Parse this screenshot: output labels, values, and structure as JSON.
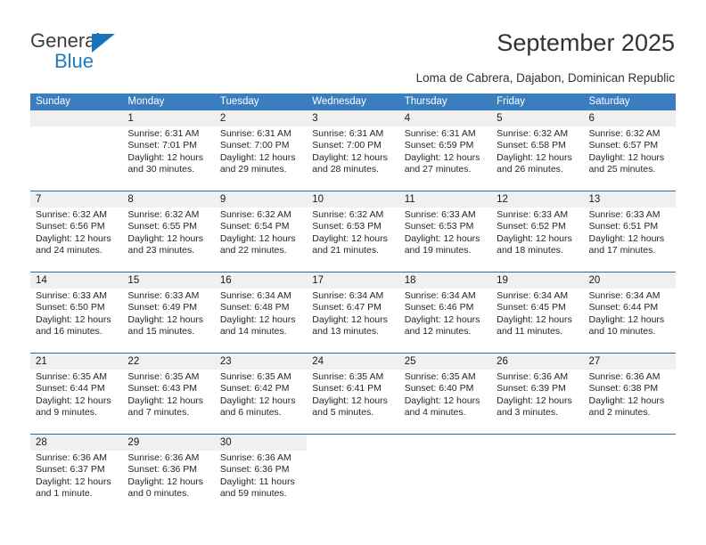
{
  "brand": {
    "name_top": "General",
    "name_bottom": "Blue",
    "accent_color": "#1a7dc4"
  },
  "header": {
    "title": "September 2025",
    "location": "Loma de Cabrera, Dajabon, Dominican Republic"
  },
  "theme": {
    "header_row_bg": "#3a7ebf",
    "day_number_bg": "#f0f0f0",
    "row_divider": "#2a6aa8"
  },
  "weekdays": [
    "Sunday",
    "Monday",
    "Tuesday",
    "Wednesday",
    "Thursday",
    "Friday",
    "Saturday"
  ],
  "weeks": [
    [
      {
        "day": "",
        "lines": []
      },
      {
        "day": "1",
        "lines": [
          "Sunrise: 6:31 AM",
          "Sunset: 7:01 PM",
          "Daylight: 12 hours",
          "and 30 minutes."
        ]
      },
      {
        "day": "2",
        "lines": [
          "Sunrise: 6:31 AM",
          "Sunset: 7:00 PM",
          "Daylight: 12 hours",
          "and 29 minutes."
        ]
      },
      {
        "day": "3",
        "lines": [
          "Sunrise: 6:31 AM",
          "Sunset: 7:00 PM",
          "Daylight: 12 hours",
          "and 28 minutes."
        ]
      },
      {
        "day": "4",
        "lines": [
          "Sunrise: 6:31 AM",
          "Sunset: 6:59 PM",
          "Daylight: 12 hours",
          "and 27 minutes."
        ]
      },
      {
        "day": "5",
        "lines": [
          "Sunrise: 6:32 AM",
          "Sunset: 6:58 PM",
          "Daylight: 12 hours",
          "and 26 minutes."
        ]
      },
      {
        "day": "6",
        "lines": [
          "Sunrise: 6:32 AM",
          "Sunset: 6:57 PM",
          "Daylight: 12 hours",
          "and 25 minutes."
        ]
      }
    ],
    [
      {
        "day": "7",
        "lines": [
          "Sunrise: 6:32 AM",
          "Sunset: 6:56 PM",
          "Daylight: 12 hours",
          "and 24 minutes."
        ]
      },
      {
        "day": "8",
        "lines": [
          "Sunrise: 6:32 AM",
          "Sunset: 6:55 PM",
          "Daylight: 12 hours",
          "and 23 minutes."
        ]
      },
      {
        "day": "9",
        "lines": [
          "Sunrise: 6:32 AM",
          "Sunset: 6:54 PM",
          "Daylight: 12 hours",
          "and 22 minutes."
        ]
      },
      {
        "day": "10",
        "lines": [
          "Sunrise: 6:32 AM",
          "Sunset: 6:53 PM",
          "Daylight: 12 hours",
          "and 21 minutes."
        ]
      },
      {
        "day": "11",
        "lines": [
          "Sunrise: 6:33 AM",
          "Sunset: 6:53 PM",
          "Daylight: 12 hours",
          "and 19 minutes."
        ]
      },
      {
        "day": "12",
        "lines": [
          "Sunrise: 6:33 AM",
          "Sunset: 6:52 PM",
          "Daylight: 12 hours",
          "and 18 minutes."
        ]
      },
      {
        "day": "13",
        "lines": [
          "Sunrise: 6:33 AM",
          "Sunset: 6:51 PM",
          "Daylight: 12 hours",
          "and 17 minutes."
        ]
      }
    ],
    [
      {
        "day": "14",
        "lines": [
          "Sunrise: 6:33 AM",
          "Sunset: 6:50 PM",
          "Daylight: 12 hours",
          "and 16 minutes."
        ]
      },
      {
        "day": "15",
        "lines": [
          "Sunrise: 6:33 AM",
          "Sunset: 6:49 PM",
          "Daylight: 12 hours",
          "and 15 minutes."
        ]
      },
      {
        "day": "16",
        "lines": [
          "Sunrise: 6:34 AM",
          "Sunset: 6:48 PM",
          "Daylight: 12 hours",
          "and 14 minutes."
        ]
      },
      {
        "day": "17",
        "lines": [
          "Sunrise: 6:34 AM",
          "Sunset: 6:47 PM",
          "Daylight: 12 hours",
          "and 13 minutes."
        ]
      },
      {
        "day": "18",
        "lines": [
          "Sunrise: 6:34 AM",
          "Sunset: 6:46 PM",
          "Daylight: 12 hours",
          "and 12 minutes."
        ]
      },
      {
        "day": "19",
        "lines": [
          "Sunrise: 6:34 AM",
          "Sunset: 6:45 PM",
          "Daylight: 12 hours",
          "and 11 minutes."
        ]
      },
      {
        "day": "20",
        "lines": [
          "Sunrise: 6:34 AM",
          "Sunset: 6:44 PM",
          "Daylight: 12 hours",
          "and 10 minutes."
        ]
      }
    ],
    [
      {
        "day": "21",
        "lines": [
          "Sunrise: 6:35 AM",
          "Sunset: 6:44 PM",
          "Daylight: 12 hours",
          "and 9 minutes."
        ]
      },
      {
        "day": "22",
        "lines": [
          "Sunrise: 6:35 AM",
          "Sunset: 6:43 PM",
          "Daylight: 12 hours",
          "and 7 minutes."
        ]
      },
      {
        "day": "23",
        "lines": [
          "Sunrise: 6:35 AM",
          "Sunset: 6:42 PM",
          "Daylight: 12 hours",
          "and 6 minutes."
        ]
      },
      {
        "day": "24",
        "lines": [
          "Sunrise: 6:35 AM",
          "Sunset: 6:41 PM",
          "Daylight: 12 hours",
          "and 5 minutes."
        ]
      },
      {
        "day": "25",
        "lines": [
          "Sunrise: 6:35 AM",
          "Sunset: 6:40 PM",
          "Daylight: 12 hours",
          "and 4 minutes."
        ]
      },
      {
        "day": "26",
        "lines": [
          "Sunrise: 6:36 AM",
          "Sunset: 6:39 PM",
          "Daylight: 12 hours",
          "and 3 minutes."
        ]
      },
      {
        "day": "27",
        "lines": [
          "Sunrise: 6:36 AM",
          "Sunset: 6:38 PM",
          "Daylight: 12 hours",
          "and 2 minutes."
        ]
      }
    ],
    [
      {
        "day": "28",
        "lines": [
          "Sunrise: 6:36 AM",
          "Sunset: 6:37 PM",
          "Daylight: 12 hours",
          "and 1 minute."
        ]
      },
      {
        "day": "29",
        "lines": [
          "Sunrise: 6:36 AM",
          "Sunset: 6:36 PM",
          "Daylight: 12 hours",
          "and 0 minutes."
        ]
      },
      {
        "day": "30",
        "lines": [
          "Sunrise: 6:36 AM",
          "Sunset: 6:36 PM",
          "Daylight: 11 hours",
          "and 59 minutes."
        ]
      },
      {
        "day": "",
        "lines": [],
        "tail": true
      },
      {
        "day": "",
        "lines": [],
        "tail": true
      },
      {
        "day": "",
        "lines": [],
        "tail": true
      },
      {
        "day": "",
        "lines": [],
        "tail": true
      }
    ]
  ]
}
